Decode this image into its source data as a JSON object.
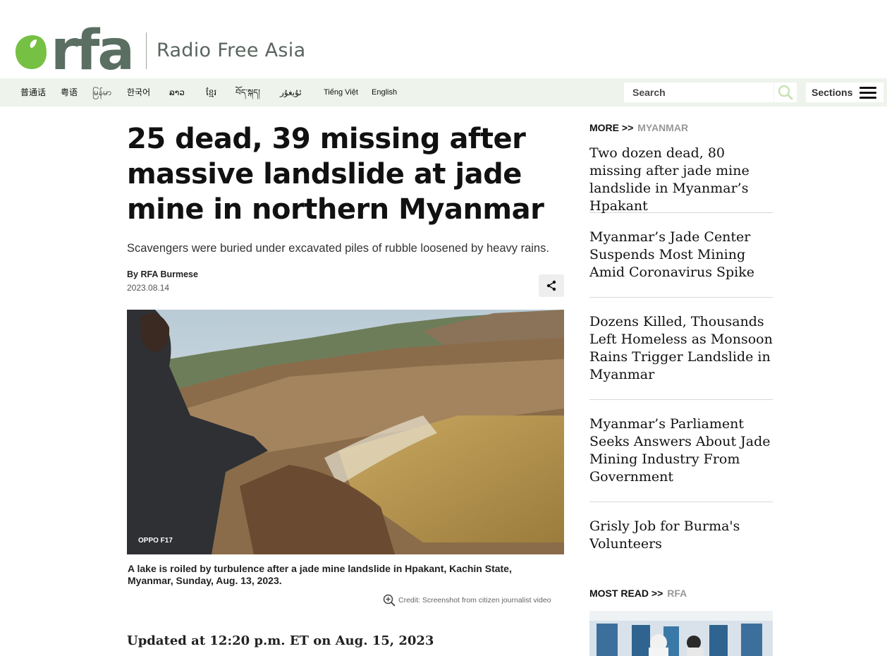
{
  "header": {
    "brand_short": "rfa",
    "brand_name": "Radio Free Asia",
    "languages": [
      "普通话",
      "粤语",
      "မြန်မာ",
      "한국어",
      "ລາວ",
      "ខ្មែរ",
      "བོད་སྐད།",
      "ئۇيغۇر",
      "Tiếng Việt",
      "English"
    ],
    "search_placeholder": "Search",
    "sections_label": "Sections",
    "accent_color": "#76c043",
    "logo_text_color": "#5a6e62"
  },
  "article": {
    "headline": "25 dead, 39 missing after massive landslide at jade mine in northern Myanmar",
    "dek": "Scavengers were buried under excavated piles of rubble loosened by heavy rains.",
    "byline": "By RFA Burmese",
    "date": "2023.08.14",
    "photo_watermark": "OPPO F17",
    "caption": "A lake is roiled by turbulence after a jade mine landslide in Hpakant, Kachin State, Myanmar, Sunday, Aug. 13, 2023.",
    "credit": "Credit: Screenshot from citizen journalist video",
    "updated": "Updated at 12:20 p.m. ET on Aug. 15, 2023"
  },
  "sidebar": {
    "more_label": "MORE >>",
    "more_section": "MYANMAR",
    "more_items": [
      "Two dozen dead, 80 missing after jade mine landslide in Myanmar’s Hpakant",
      "Myanmar’s Jade Center Suspends Most Mining Amid Coronavirus Spike",
      "Dozens Killed, Thousands Left Homeless as Monsoon Rains Trigger Landslide in Myanmar",
      "Myanmar’s Parliament Seeks Answers About Jade Mining Industry From Government",
      "Grisly Job for Burma's Volunteers"
    ],
    "most_read_label": "MOST READ >>",
    "most_read_section": "RFA"
  }
}
